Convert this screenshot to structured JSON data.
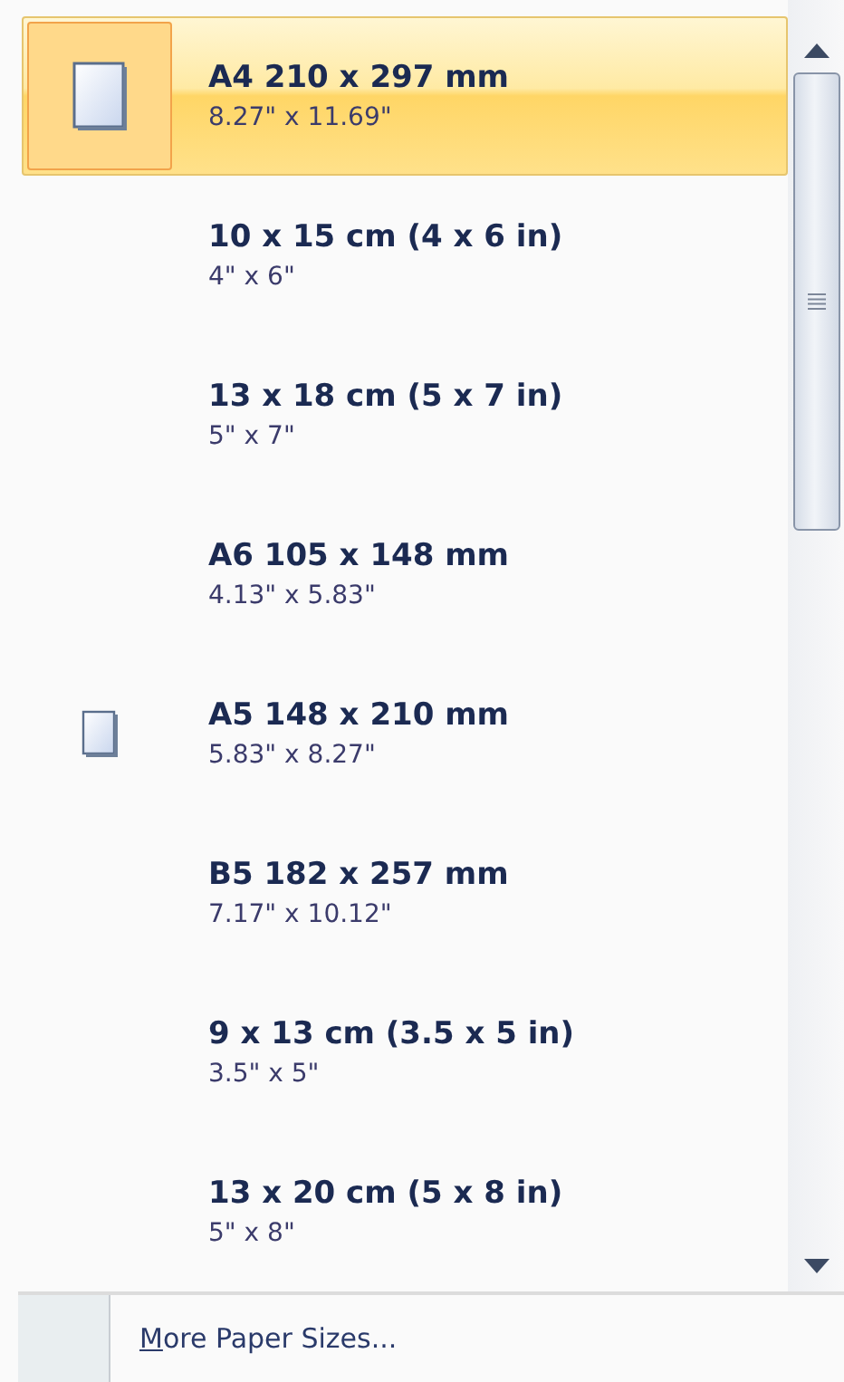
{
  "items": [
    {
      "title": "A4 210 x 297 mm",
      "subtitle": "8.27\" x 11.69\"",
      "kind": "page-large",
      "selected": true
    },
    {
      "title": "10 x 15 cm (4 x 6 in)",
      "subtitle": "4\" x 6\"",
      "kind": "plain",
      "selected": false
    },
    {
      "title": "13 x 18 cm (5 x 7 in)",
      "subtitle": "5\" x 7\"",
      "kind": "plain",
      "selected": false
    },
    {
      "title": "A6 105 x 148 mm",
      "subtitle": "4.13\" x 5.83\"",
      "kind": "plain",
      "selected": false
    },
    {
      "title": "A5 148 x 210 mm",
      "subtitle": "5.83\" x 8.27\"",
      "kind": "page-small",
      "selected": false
    },
    {
      "title": "B5 182 x 257 mm",
      "subtitle": "7.17\" x 10.12\"",
      "kind": "plain",
      "selected": false
    },
    {
      "title": "9 x 13 cm (3.5 x 5 in)",
      "subtitle": "3.5\" x 5\"",
      "kind": "plain",
      "selected": false
    },
    {
      "title": "13 x 20 cm (5 x 8 in)",
      "subtitle": "5\" x 8\"",
      "kind": "plain",
      "selected": false
    }
  ],
  "footer": {
    "access_key": "M",
    "label_rest": "ore Paper Sizes..."
  }
}
